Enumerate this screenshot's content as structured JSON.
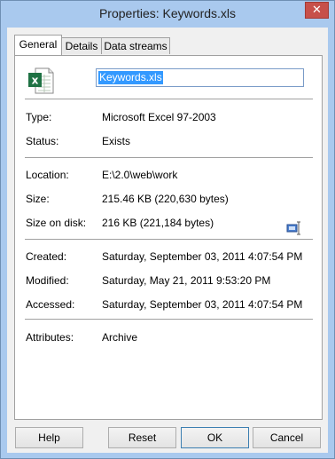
{
  "window": {
    "title": "Properties: Keywords.xls",
    "close_glyph": "✕"
  },
  "tabs": [
    {
      "label": "General",
      "active": true
    },
    {
      "label": "Details",
      "active": false
    },
    {
      "label": "Data streams",
      "active": false
    }
  ],
  "file": {
    "icon": "excel-file-icon",
    "name": "Keywords.xls"
  },
  "props": {
    "type_label": "Type:",
    "type_value": "Microsoft Excel 97-2003",
    "status_label": "Status:",
    "status_value": "Exists",
    "location_label": "Location:",
    "location_value": "E:\\2.0\\web\\work",
    "size_label": "Size:",
    "size_value": "215.46 KB (220,630 bytes)",
    "size_on_disk_label": "Size on disk:",
    "size_on_disk_value": "216 KB (221,184 bytes)",
    "created_label": "Created:",
    "created_value": "Saturday, September 03, 2011 4:07:54 PM",
    "modified_label": "Modified:",
    "modified_value": "Saturday, May 21, 2011 9:53:20 PM",
    "accessed_label": "Accessed:",
    "accessed_value": "Saturday, September 03, 2011 4:07:54 PM",
    "attributes_label": "Attributes:",
    "attributes_value": "Archive"
  },
  "buttons": {
    "help": "Help",
    "reset": "Reset",
    "ok": "OK",
    "cancel": "Cancel"
  },
  "colors": {
    "titlebar": "#a9c9ee",
    "close": "#c7504a",
    "selection": "#3399ff",
    "excel_green": "#1f7244"
  }
}
